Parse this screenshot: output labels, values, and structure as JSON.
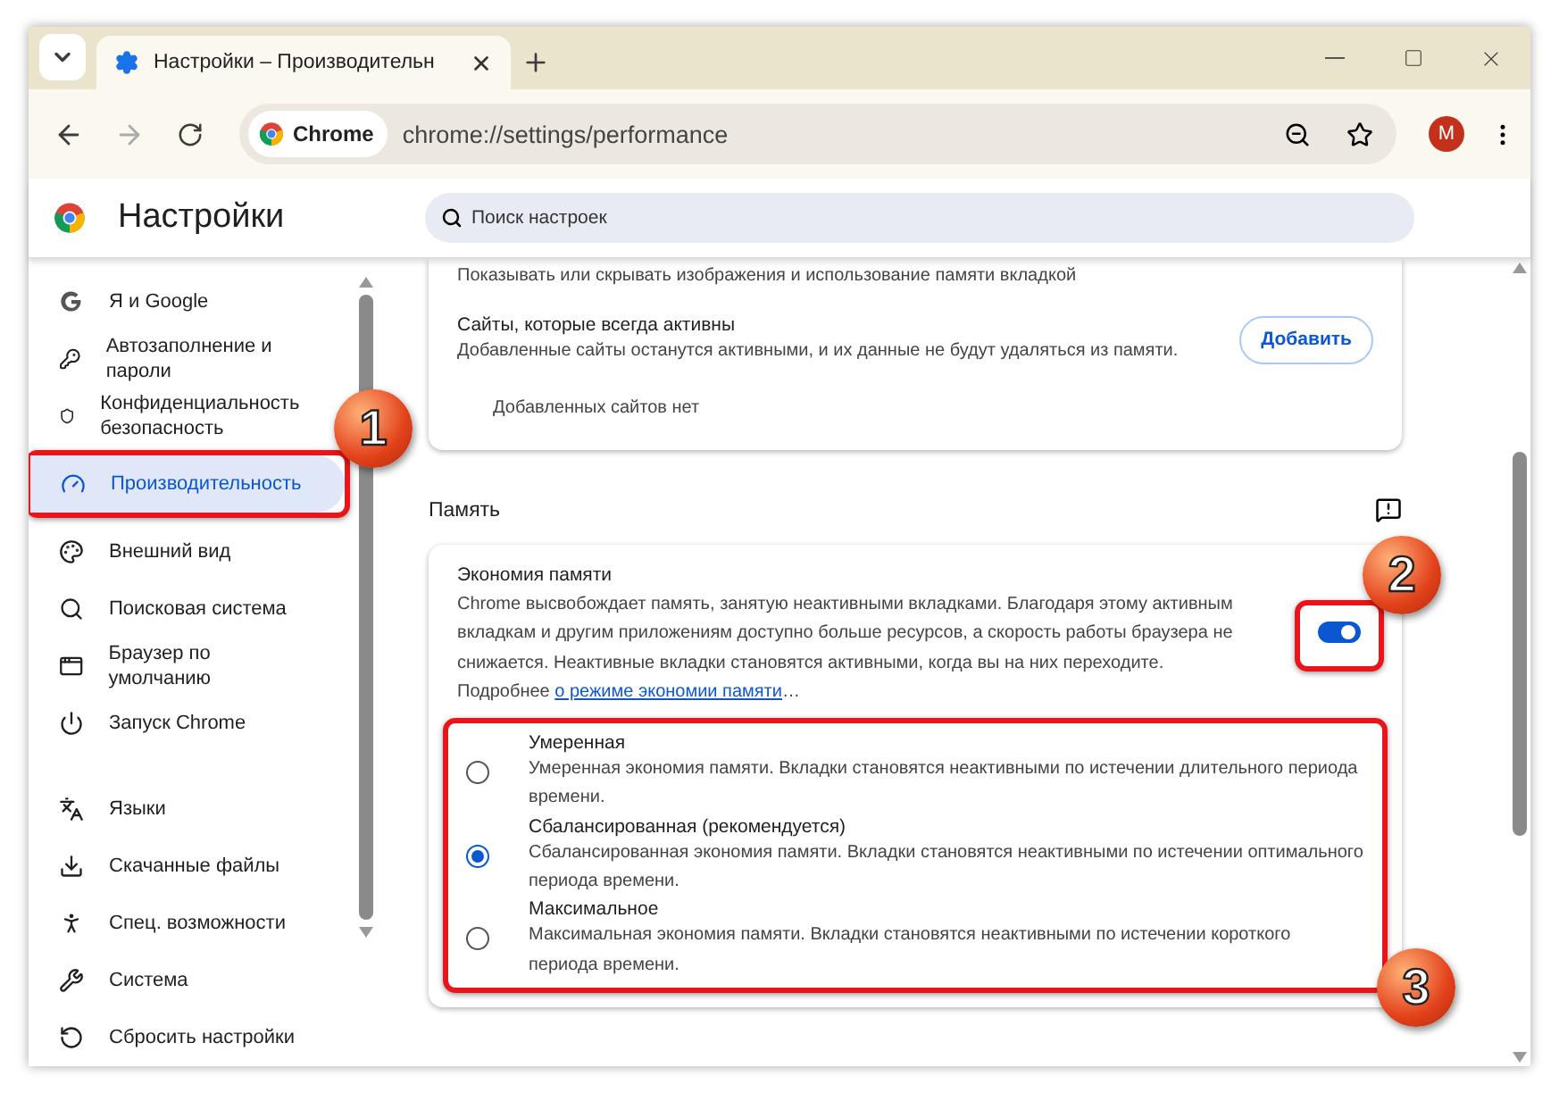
{
  "tab_strip": {
    "tab": {
      "title": "Настройки – Производительн"
    }
  },
  "toolbar": {
    "site_chip": "Chrome",
    "url": "chrome://settings/performance",
    "avatar": "M"
  },
  "header": {
    "title": "Настройки",
    "search": {
      "placeholder": "Поиск настроек"
    }
  },
  "sidebar": {
    "groups": [
      {
        "items": [
          {
            "label": "Я и Google",
            "kind": "google",
            "selected": false
          },
          {
            "label": "Автозаполнение и пароли",
            "kind": "key",
            "selected": false
          },
          {
            "label": "Конфиденциальность безопасность",
            "kind": "shield",
            "selected": false
          },
          {
            "label": "Производительность",
            "kind": "gauge",
            "selected": true
          },
          {
            "label": "Внешний вид",
            "kind": "palette",
            "selected": false
          },
          {
            "label": "Поисковая система",
            "kind": "search",
            "selected": false
          },
          {
            "label": "Браузер по умолчанию",
            "kind": "window",
            "selected": false
          },
          {
            "label": "Запуск Chrome",
            "kind": "power",
            "selected": false
          }
        ]
      },
      {
        "items": [
          {
            "label": "Языки",
            "kind": "languages",
            "selected": false
          },
          {
            "label": "Скачанные файлы",
            "kind": "download",
            "selected": false
          },
          {
            "label": "Спец. возможности",
            "kind": "accessibility",
            "selected": false
          },
          {
            "label": "Система",
            "kind": "wrench",
            "selected": false
          },
          {
            "label": "Сбросить настройки",
            "kind": "reset",
            "selected": false
          }
        ]
      }
    ]
  },
  "tabs_card": {
    "top_text": "Показывать или скрывать изображения и использование памяти вкладкой",
    "always_active": {
      "title": "Сайты, которые всегда активны",
      "description": "Добавленные сайты останутся активными, и их данные не будут удаляться из памяти.",
      "button": "Добавить",
      "empty": "Добавленных сайтов нет"
    }
  },
  "memory": {
    "heading": "Память",
    "saver": {
      "title": "Экономия памяти",
      "description": "Chrome высвобождает память, занятую неактивными вкладками. Благодаря этому активным вкладкам и другим приложениям доступно больше ресурсов, а скорость работы браузера не снижается. Неактивные вкладки становятся активными, когда вы на них переходите. Подробнее ",
      "link": "о режиме экономии памяти",
      "after_link": "…",
      "on": true
    },
    "modes": [
      {
        "label": "Умеренная",
        "description": "Умеренная экономия памяти. Вкладки становятся неактивными по истечении длительного периода времени.",
        "selected": false
      },
      {
        "label": "Сбалансированная (рекомендуется)",
        "description": "Сбалансированная экономия памяти. Вкладки становятся неактивными по истечении оптимального периода времени.",
        "selected": true
      },
      {
        "label": "Максимальное",
        "description": "Максимальная экономия памяти. Вкладки становятся неактивными по истечении короткого периода времени.",
        "selected": false
      }
    ]
  },
  "annotations": [
    {
      "number": "1"
    },
    {
      "number": "2"
    },
    {
      "number": "3"
    }
  ]
}
